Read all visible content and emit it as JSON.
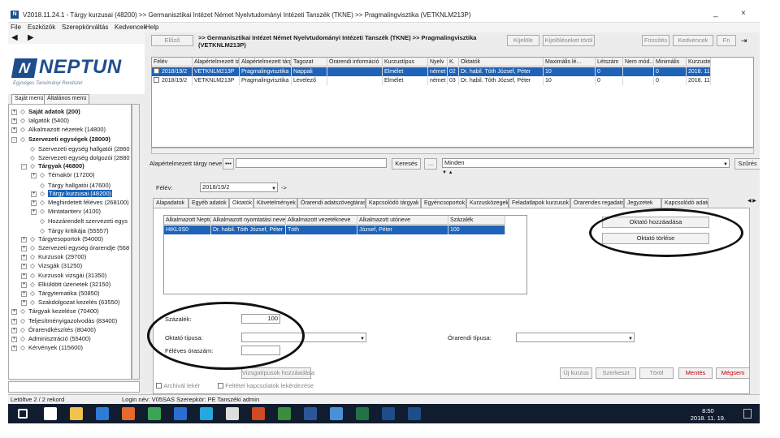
{
  "window": {
    "title": "V2018.11.24.1 - Tárgy kurzusai (48200) >> Germanisztikai Intézet Német Nyelvtudományi Intézeti Tanszék (TKNE) >> Pragmalingvisztika (VETKNLM213P)",
    "minimize": "_",
    "close": "×"
  },
  "menu": [
    "File",
    "Eszközök",
    "Szerepkörváltás",
    "Kedvencek",
    "Help"
  ],
  "nav": {
    "back": "◀",
    "forward": "▶"
  },
  "logo": {
    "mark": "N",
    "name": "NEPTUN",
    "subtitle": "Egységes Tanulmányi Rendszer"
  },
  "left_tabs": [
    "Saját menü",
    "Általános menü"
  ],
  "tree": [
    {
      "label": "Saját adatok (200)",
      "bold": true,
      "indent": 0,
      "exp": "+"
    },
    {
      "label": "Ialgatók (5400)",
      "bold": false,
      "indent": 0,
      "exp": "+"
    },
    {
      "label": "Alkalmazott nézetek (14800)",
      "bold": false,
      "indent": 0,
      "exp": "+"
    },
    {
      "label": "Szervezeti egységek (28000)",
      "bold": true,
      "indent": 0,
      "exp": "-"
    },
    {
      "label": "Szervezeti egység hallgatói (2860",
      "bold": false,
      "indent": 1,
      "exp": ""
    },
    {
      "label": "Szervezeti egység dolgozói (2880",
      "bold": false,
      "indent": 1,
      "exp": ""
    },
    {
      "label": "Tárgyak (46800)",
      "bold": true,
      "indent": 1,
      "exp": "-"
    },
    {
      "label": "Témakör (17200)",
      "bold": false,
      "indent": 2,
      "exp": "+"
    },
    {
      "label": "Tárgy hallgatói (47600)",
      "bold": false,
      "indent": 2,
      "exp": ""
    },
    {
      "label": "Tárgy kurzusai (48200)",
      "bold": false,
      "indent": 2,
      "exp": "+",
      "selected": true
    },
    {
      "label": "Meghirdetett féléves (268100)",
      "bold": false,
      "indent": 2,
      "exp": "+"
    },
    {
      "label": "Mintatanterv (4100)",
      "bold": false,
      "indent": 2,
      "exp": "+"
    },
    {
      "label": "Hozzárendelt szervezeti egys",
      "bold": false,
      "indent": 2,
      "exp": ""
    },
    {
      "label": "Tárgy kritikája (55557)",
      "bold": false,
      "indent": 2,
      "exp": ""
    },
    {
      "label": "Tárgyesoportok (54000)",
      "bold": false,
      "indent": 1,
      "exp": "+"
    },
    {
      "label": "Szervezeti egység órarendje (568",
      "bold": false,
      "indent": 1,
      "exp": "+"
    },
    {
      "label": "Kurzusok (29700)",
      "bold": false,
      "indent": 1,
      "exp": "+"
    },
    {
      "label": "Vizsgák (31250)",
      "bold": false,
      "indent": 1,
      "exp": "+"
    },
    {
      "label": "Kurzusok vizsgái (31350)",
      "bold": false,
      "indent": 1,
      "exp": "+"
    },
    {
      "label": "Elküldött üzenetek (32150)",
      "bold": false,
      "indent": 1,
      "exp": "+"
    },
    {
      "label": "Tárgytematika (50850)",
      "bold": false,
      "indent": 1,
      "exp": "+"
    },
    {
      "label": "Szakdolgozat kezelés (63550)",
      "bold": false,
      "indent": 1,
      "exp": "+"
    },
    {
      "label": "Tárgyak kezelése (70400)",
      "bold": false,
      "indent": 0,
      "exp": "+"
    },
    {
      "label": "Teljesítményigazolvodás (83400)",
      "bold": false,
      "indent": 0,
      "exp": "+"
    },
    {
      "label": "Órarendkészítés (80400)",
      "bold": false,
      "indent": 0,
      "exp": "+"
    },
    {
      "label": "Adminisztráció (55400)",
      "bold": false,
      "indent": 0,
      "exp": "+"
    },
    {
      "label": "Kérvények (115600)",
      "bold": false,
      "indent": 0,
      "exp": "+"
    }
  ],
  "toolbar_top": {
    "back": "Előző",
    "path": ">> Germanisztikai Intézet Német Nyelvtudományi Intézeti Tanszék (TKNE) >> Pragmalingvisztika (VETKNLM213P)",
    "print": "Kijelöle",
    "deselect_all": "Kijelöléseket töröl",
    "refresh": "Frissítés",
    "favorites": "Kedvencek",
    "help": "Fn"
  },
  "top_grid": {
    "columns": [
      "Félév",
      "Alapértelmezett tá...",
      "Alapértelmezett tárgy neve",
      "Tagozat",
      "Órarendi információ",
      "Kurzustípus",
      "Nyelv",
      "K.",
      "Oktatók",
      "Maximális lé...",
      "Létszám",
      "Nem mód...",
      "Minimális",
      "Kurzuste"
    ],
    "rows": [
      [
        "2018/19/2",
        "VETKNLM213P",
        "Pragmalingvisztika",
        "Nappali",
        "",
        "Elmélet",
        "német",
        "02",
        "Dr. habil. Tóth József, Péter",
        "10",
        "0",
        "",
        "0",
        "2018. 11."
      ],
      [
        "2018/19/2",
        "VETKNLM213P",
        "Pragmalingvisztika",
        "Levelező",
        "",
        "Elmélet",
        "német",
        "03",
        "Dr. habil. Tóth József, Péter",
        "10",
        "0",
        "",
        "0",
        "2018. 11."
      ]
    ]
  },
  "search": {
    "label": "Alapértelmezett tárgy neve",
    "value": "",
    "search_button": "Keresés",
    "dots_button": "...",
    "combo_value": "Minden",
    "filter_button": "Szűrés"
  },
  "semester": {
    "label": "Félév:",
    "value": "2018/19/2",
    "arrow": "->"
  },
  "tabs": [
    "Alapadatok",
    "Egyéb adatok",
    "Oktatók",
    "Követelmények",
    "Órarendi adatszövegtáras",
    "Kapcsolódó tárgyak",
    "Egyéncsoportok",
    "Kurzusközegek",
    "Feladatlapok kurzusok",
    "Órarendes regadatok",
    "Jegyzetek",
    "Kapcsolódó adatok"
  ],
  "active_tab": "Oktatók",
  "instructor_grid": {
    "columns": [
      "Alkalmazott Neptu...",
      "Alkalmazott nyomtatási neve",
      "Alkalmazott vezetékneve",
      "Alkalmazott utóneve",
      "Százalék"
    ],
    "rows": [
      [
        "HIKL0S0",
        "Dr. habil. Tóth József, Péter",
        "Tóth",
        "József, Péter",
        "100"
      ]
    ]
  },
  "right_buttons": {
    "add_instructor": "Oktató hozzáadása",
    "delete_instructor": "Oktató törlése"
  },
  "form": {
    "percent_label": "Százalék:",
    "percent_value": "100",
    "teacher_type_label": "Oktató típusa:",
    "semester_hours_label": "Féléves óraszám:",
    "class_type_label": "Órarendi típusa:",
    "exam_button": "Vizsgatípusok hozzáadása"
  },
  "bottom_buttons": {
    "new": "Új kurzus",
    "edit": "Szerkeszt",
    "delete": "Töröl",
    "save": "Mentés",
    "cancel": "Mégsem"
  },
  "checkboxes": {
    "archive": "Archivál lekér",
    "hidden": "Feltétel kapcsolatok lekérdezése"
  },
  "status": {
    "records": "Letöltve 2 / 2 rekord",
    "user": "Login név: V05SAS  Szerepkör: PE Tanszéki admin"
  },
  "clock": {
    "time": "8:50",
    "date": "2018. 11. 19."
  },
  "taskbar_icons": [
    {
      "name": "start-icon",
      "color": "#ffffff"
    },
    {
      "name": "search-icon",
      "color": "#ffffff"
    },
    {
      "name": "file-explorer-icon",
      "color": "#f2c14e"
    },
    {
      "name": "edge-icon",
      "color": "#2f7bd8"
    },
    {
      "name": "firefox-icon",
      "color": "#e66a2c"
    },
    {
      "name": "chrome-icon",
      "color": "#3aa655"
    },
    {
      "name": "outlook-icon",
      "color": "#2a6ed1"
    },
    {
      "name": "skype-icon",
      "color": "#25a8e0"
    },
    {
      "name": "file-icon",
      "color": "#dddddd"
    },
    {
      "name": "powerpoint-icon",
      "color": "#d04a26"
    },
    {
      "name": "flag-icon",
      "color": "#3c8d40"
    },
    {
      "name": "word-icon",
      "color": "#2b579a"
    },
    {
      "name": "media-icon",
      "color": "#4a90d9"
    },
    {
      "name": "excel-icon",
      "color": "#217346"
    },
    {
      "name": "neptun-icon",
      "color": "#1e4d8c"
    },
    {
      "name": "neptun-icon-2",
      "color": "#1e4d8c"
    }
  ]
}
